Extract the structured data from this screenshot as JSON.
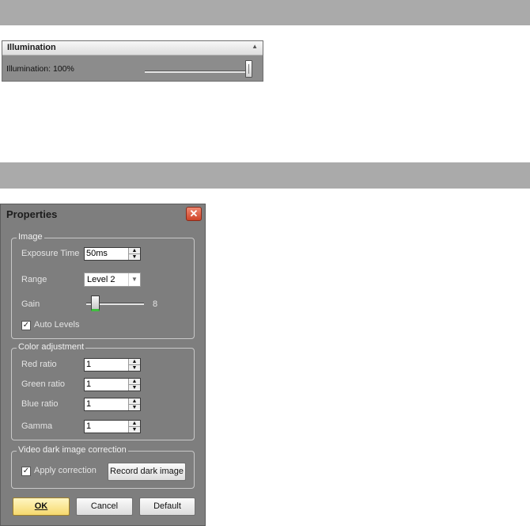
{
  "illumination": {
    "header": "Illumination",
    "collapse_icon": "chevron-up-icon",
    "label": "Illumination: 100%",
    "slider_fraction": 1.0
  },
  "dialog": {
    "title": "Properties",
    "close_icon": "close-icon",
    "image_group": {
      "legend": "Image",
      "exposure_label": "Exposure Time",
      "exposure_value": "50ms",
      "range_label": "Range",
      "range_value": "Level 2",
      "gain_label": "Gain",
      "gain_value": "8",
      "gain_fraction": 0.1,
      "auto_levels_label": "Auto Levels",
      "auto_levels_checked": true
    },
    "color_group": {
      "legend": "Color adjustment",
      "red_label": "Red ratio",
      "red_value": "1",
      "green_label": "Green ratio",
      "green_value": "1",
      "blue_label": "Blue ratio",
      "blue_value": "1",
      "gamma_label": "Gamma",
      "gamma_value": "1"
    },
    "dark_group": {
      "legend": "Video dark image correction",
      "apply_label": "Apply correction",
      "apply_checked": true,
      "record_button": "Record dark image"
    },
    "buttons": {
      "ok": "OK",
      "cancel": "Cancel",
      "default": "Default"
    }
  }
}
